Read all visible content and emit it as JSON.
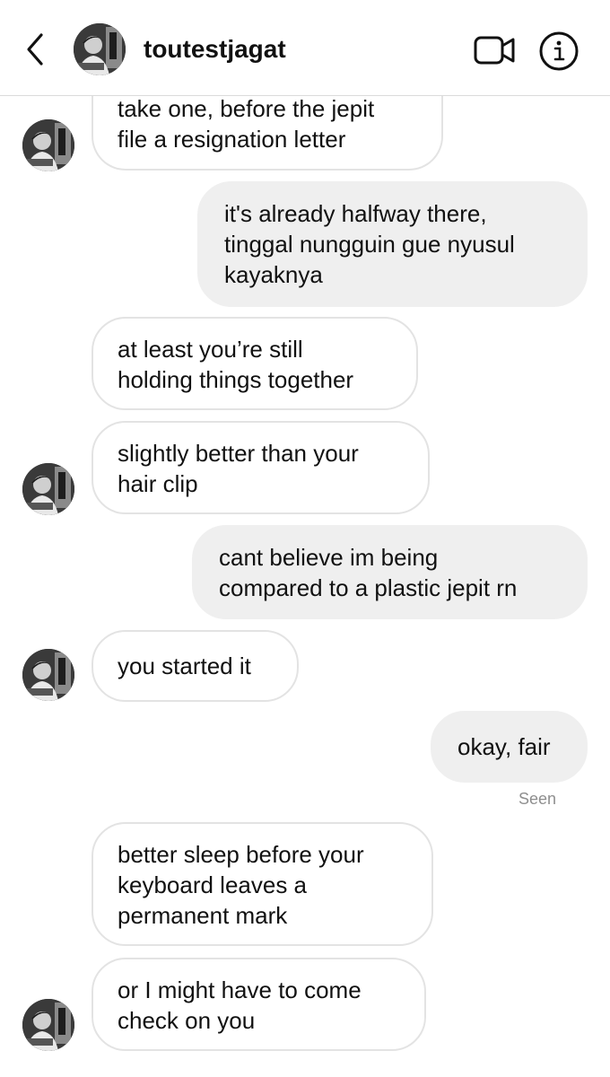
{
  "header": {
    "username": "toutestjagat",
    "back_icon": "chevron-left-icon",
    "video_icon": "video-camera-icon",
    "info_icon": "info-icon"
  },
  "colors": {
    "incoming_bubble_bg": "#ffffff",
    "incoming_bubble_border": "#e3e3e3",
    "outgoing_bubble_bg": "#efefef",
    "text": "#111111",
    "seen_text": "#8e8e8e"
  },
  "messages": [
    {
      "sender": "them",
      "lines": [
        "take one, before the jepit",
        "file a resignation letter"
      ]
    },
    {
      "sender": "me",
      "lines": [
        "it's already halfway there,",
        "tinggal nungguin gue nyusul",
        "kayaknya"
      ]
    },
    {
      "sender": "them",
      "lines": [
        "at least you’re still",
        "holding things together"
      ]
    },
    {
      "sender": "them",
      "lines": [
        "slightly better than your",
        "hair clip"
      ]
    },
    {
      "sender": "me",
      "lines": [
        "cant believe im being",
        "compared to a plastic jepit rn"
      ]
    },
    {
      "sender": "them",
      "lines": [
        "you started it"
      ]
    },
    {
      "sender": "me",
      "lines": [
        "okay, fair"
      ]
    },
    {
      "sender": "them",
      "lines": [
        "better sleep before your",
        "keyboard leaves a",
        "permanent mark"
      ]
    },
    {
      "sender": "them",
      "lines": [
        "or I might have to come",
        "check on you"
      ]
    }
  ],
  "seen_label": "Seen"
}
